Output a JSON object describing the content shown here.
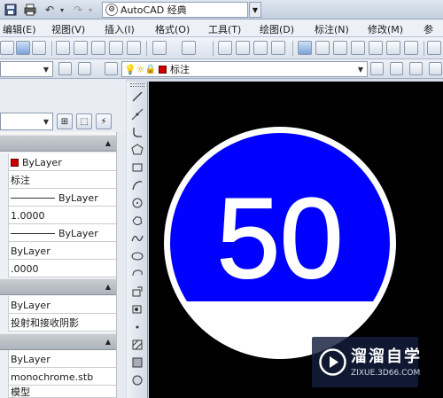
{
  "titlebar": {
    "workspace": "AutoCAD 经典"
  },
  "menu": {
    "items": [
      "编辑(E)",
      "视图(V)",
      "插入(I)",
      "格式(O)",
      "工具(T)",
      "绘图(D)",
      "标注(N)",
      "修改(M)",
      "参"
    ]
  },
  "toolbar2": {
    "layer_value": "标注",
    "layer_color": "#cc0000"
  },
  "properties": {
    "rows": [
      {
        "value": "ByLayer",
        "has_swatch": true
      },
      {
        "value": "标注"
      },
      {
        "value": "ByLayer",
        "linetype": true
      },
      {
        "value": "1.0000"
      },
      {
        "value": "ByLayer",
        "linetype": true
      },
      {
        "value": "ByLayer"
      },
      {
        "value": ".0000"
      },
      {
        "value": "ByLayer"
      },
      {
        "value": "投射和接收阴影"
      },
      {
        "value": "ByLayer"
      },
      {
        "value": "monochrome.stb"
      },
      {
        "value": "模型"
      }
    ]
  },
  "drawing": {
    "sign_text": "50",
    "sign_color": "#0000ff",
    "sign_text_color": "#ffffff",
    "background_color": "#000000"
  },
  "watermark": {
    "title": "溜溜自学",
    "url": "ZIXUE.3D66.COM"
  },
  "colors": {
    "accent": "#cc0000",
    "panel_header": "#b4bac2"
  }
}
